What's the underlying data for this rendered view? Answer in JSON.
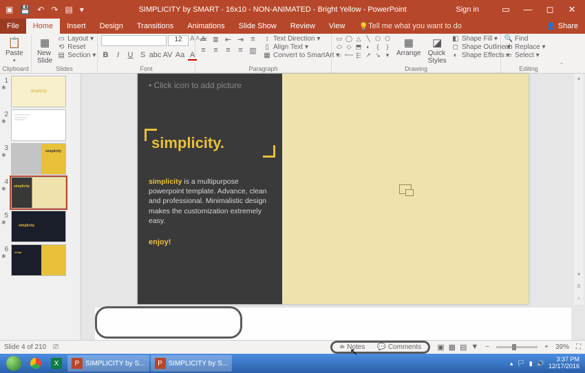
{
  "titlebar": {
    "title": "SIMPLICITY by SMART - 16x10 - NON-ANIMATED - Bright Yellow  -  PowerPoint",
    "signin": "Sign in"
  },
  "tabs": {
    "file": "File",
    "home": "Home",
    "insert": "Insert",
    "design": "Design",
    "transitions": "Transitions",
    "animations": "Animations",
    "slideshow": "Slide Show",
    "review": "Review",
    "view": "View",
    "tellme": "Tell me what you want to do",
    "share": "Share"
  },
  "ribbon": {
    "clipboard": {
      "label": "Clipboard",
      "paste": "Paste"
    },
    "slides": {
      "label": "Slides",
      "newslide": "New\nSlide",
      "layout": "Layout ▾",
      "reset": "Reset",
      "section": "Section ▾"
    },
    "font": {
      "label": "Font",
      "size": "12"
    },
    "paragraph": {
      "label": "Paragraph",
      "textdir": "Text Direction ▾",
      "align": "Align Text ▾",
      "smartart": "Convert to SmartArt ▾"
    },
    "drawing": {
      "label": "Drawing",
      "arrange": "Arrange",
      "quick": "Quick\nStyles",
      "fill": "Shape Fill ▾",
      "outline": "Shape Outline ▾",
      "effects": "Shape Effects ▾"
    },
    "editing": {
      "label": "Editing",
      "find": "Find",
      "replace": "Replace ▾",
      "select": "Select ▾"
    }
  },
  "thumbs": [
    {
      "n": "1",
      "star": "✱"
    },
    {
      "n": "2",
      "star": "✱"
    },
    {
      "n": "3",
      "star": "✱"
    },
    {
      "n": "4",
      "star": "✱"
    },
    {
      "n": "5",
      "star": "✱"
    },
    {
      "n": "6",
      "star": "✱"
    }
  ],
  "slide": {
    "hint": "• Click icon to add picture",
    "title": "simplicity.",
    "desc_hl": "simplicity",
    "desc_rest": " is a multipurpose powerpoint template. Advance, clean and professional. Minimalistic design makes the customization extremely easy.",
    "enjoy": "enjoy!"
  },
  "status": {
    "slideinfo": "Slide 4 of 210",
    "lang": "⎚",
    "notes": "Notes",
    "comments": "Comments",
    "zoom": "39%"
  },
  "taskbar": {
    "ppt1": "SIMPLICITY by S...",
    "ppt2": "SIMPLICITY by S...",
    "time": "3:37 PM",
    "date": "12/17/2016"
  }
}
